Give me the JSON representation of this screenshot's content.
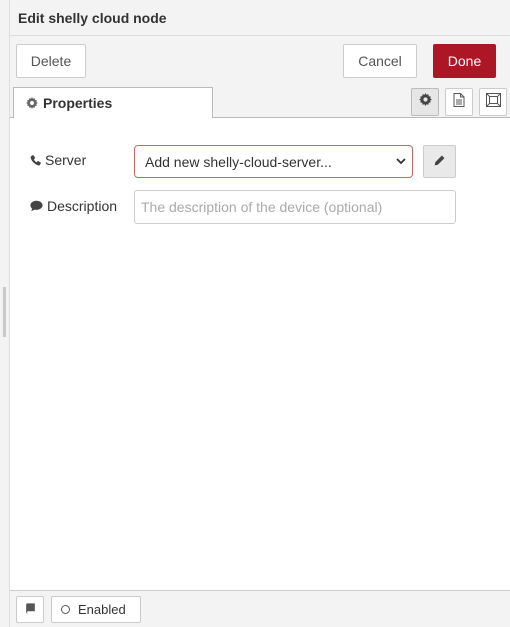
{
  "header": {
    "title": "Edit shelly cloud node"
  },
  "toolbar": {
    "delete_label": "Delete",
    "cancel_label": "Cancel",
    "done_label": "Done"
  },
  "tabs": [
    {
      "label": "Properties",
      "icon": "gear-icon"
    }
  ],
  "tab_icons": [
    "gear-icon",
    "document-icon",
    "frame-icon"
  ],
  "form": {
    "server": {
      "label": "Server",
      "icon": "phone-icon",
      "selected": "Add new shelly-cloud-server..."
    },
    "description": {
      "label": "Description",
      "icon": "comment-icon",
      "value": "",
      "placeholder": "The description of the device (optional)"
    }
  },
  "footer": {
    "enabled_label": "Enabled",
    "book_icon": "book-icon"
  },
  "colors": {
    "accent": "#ad1625",
    "error_border": "#d6615f",
    "panel_bg": "#f3f3f3"
  }
}
